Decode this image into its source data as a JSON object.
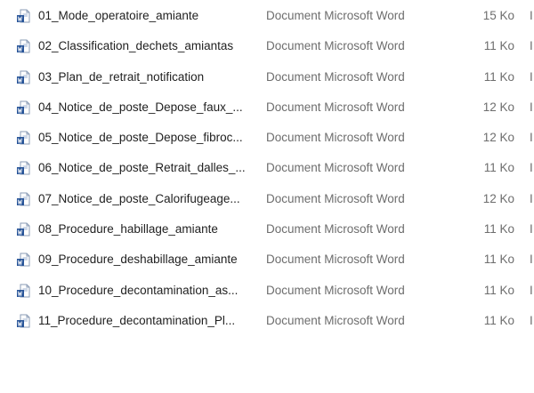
{
  "files": [
    {
      "name": "01_Mode_operatoire_amiante",
      "type": "Document Microsoft Word",
      "size": "15 Ko",
      "icon": "word-doc-icon"
    },
    {
      "name": "02_Classification_dechets_amiantas",
      "type": "Document Microsoft Word",
      "size": "11 Ko",
      "icon": "word-doc-icon"
    },
    {
      "name": "03_Plan_de_retrait_notification",
      "type": "Document Microsoft Word",
      "size": "11 Ko",
      "icon": "word-doc-icon"
    },
    {
      "name": "04_Notice_de_poste_Depose_faux_...",
      "type": "Document Microsoft Word",
      "size": "12 Ko",
      "icon": "word-doc-icon"
    },
    {
      "name": "05_Notice_de_poste_Depose_fibroc...",
      "type": "Document Microsoft Word",
      "size": "12 Ko",
      "icon": "word-doc-icon"
    },
    {
      "name": "06_Notice_de_poste_Retrait_dalles_...",
      "type": "Document Microsoft Word",
      "size": "11 Ko",
      "icon": "word-doc-icon"
    },
    {
      "name": "07_Notice_de_poste_Calorifugeage...",
      "type": "Document Microsoft Word",
      "size": "12 Ko",
      "icon": "word-doc-icon"
    },
    {
      "name": "08_Procedure_habillage_amiante",
      "type": "Document Microsoft Word",
      "size": "11 Ko",
      "icon": "word-doc-icon"
    },
    {
      "name": "09_Procedure_deshabillage_amiante",
      "type": "Document Microsoft Word",
      "size": "11 Ko",
      "icon": "word-doc-icon"
    },
    {
      "name": "10_Procedure_decontamination_as...",
      "type": "Document Microsoft Word",
      "size": "11 Ko",
      "icon": "word-doc-icon"
    },
    {
      "name": "11_Procedure_decontamination_Pl...",
      "type": "Document Microsoft Word",
      "size": "11 Ko",
      "icon": "word-doc-icon"
    }
  ],
  "extra_column_glyph": "I",
  "colors": {
    "word_blue": "#2b579a",
    "text": "#1f1f1f",
    "muted": "#6d6d6d"
  }
}
